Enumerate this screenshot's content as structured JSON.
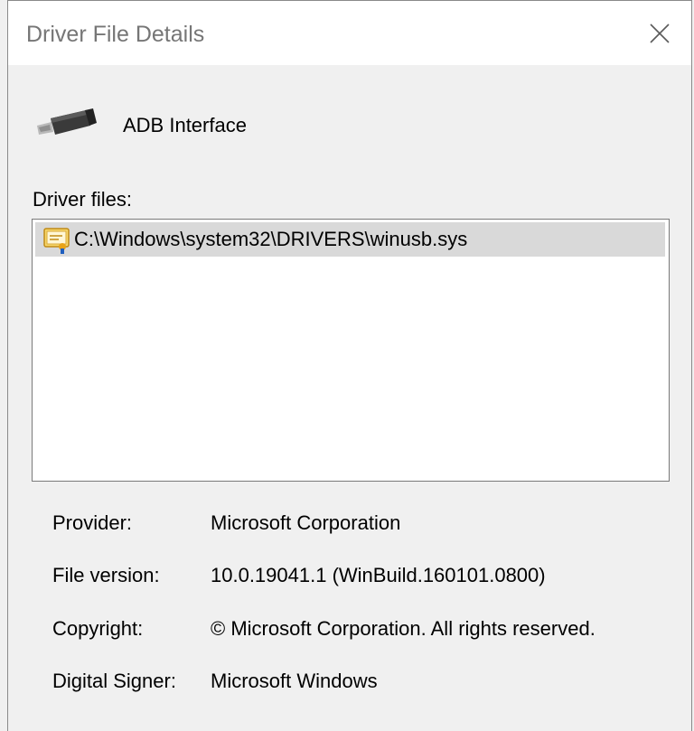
{
  "window": {
    "title": "Driver File Details"
  },
  "device": {
    "name": "ADB Interface"
  },
  "files": {
    "label": "Driver files:",
    "items": [
      {
        "path": "C:\\Windows\\system32\\DRIVERS\\winusb.sys"
      }
    ]
  },
  "details": [
    {
      "label": "Provider:",
      "value": "Microsoft Corporation"
    },
    {
      "label": "File version:",
      "value": "10.0.19041.1 (WinBuild.160101.0800)"
    },
    {
      "label": "Copyright:",
      "value": "© Microsoft Corporation. All rights reserved."
    },
    {
      "label": "Digital Signer:",
      "value": "Microsoft Windows"
    }
  ],
  "icons": {
    "close": "close-icon",
    "device": "usb-plug-icon",
    "file": "certificate-file-icon"
  }
}
